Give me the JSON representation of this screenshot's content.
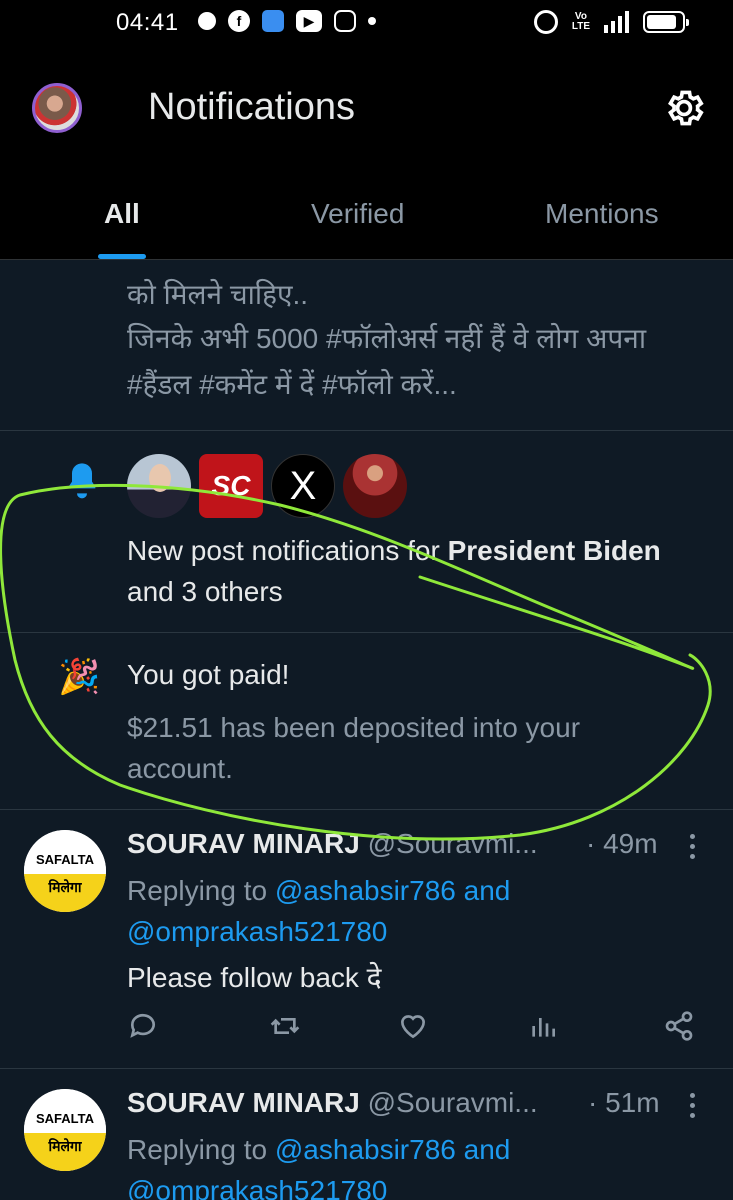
{
  "status_bar": {
    "time": "04:41",
    "network": "4G",
    "volte": "Vo\nLTE",
    "battery_level": 0.85
  },
  "header": {
    "title": "Notifications"
  },
  "tabs": [
    {
      "label": "All",
      "active": true
    },
    {
      "label": "Verified",
      "active": false
    },
    {
      "label": "Mentions",
      "active": false
    }
  ],
  "partial_post": {
    "lines": [
      "को मिलने चाहिए..",
      "जिनके अभी 5000 #फॉलोअर्स नहीं हैं वे लोग अपना",
      "#हैंडल #कमेंट में दें #फॉलो करें..."
    ]
  },
  "post_notification": {
    "prefix": "New post notifications for ",
    "name": "President Biden",
    "suffix": " and 3 others",
    "avatars": [
      "President Biden",
      "SC",
      "X",
      "group"
    ],
    "sc_label": "SC",
    "x_label": "X"
  },
  "payment": {
    "title": "You got paid!",
    "description": "$21.51 has been deposited into your account."
  },
  "replies": [
    {
      "avatar_top": "SAFALTA",
      "avatar_bottom": "मिलेगा",
      "name": "SOURAV MINARJ",
      "handle": "@Souravmi...",
      "time": "· 49m",
      "replying_prefix": "Replying to ",
      "reply_to_1": "@ashabsir786 and",
      "reply_to_2": "@omprakash521780",
      "body": "Please follow back दे"
    },
    {
      "avatar_top": "SAFALTA",
      "avatar_bottom": "मिलेगा",
      "name": "SOURAV MINARJ",
      "handle": "@Souravmi...",
      "time": "· 51m",
      "replying_prefix": "Replying to ",
      "reply_to_1": "@ashabsir786 and",
      "reply_to_2": "@omprakash521780"
    }
  ],
  "colors": {
    "accent": "#1d9bf0",
    "background": "#0f1a25",
    "annotation": "#8fe83a"
  }
}
